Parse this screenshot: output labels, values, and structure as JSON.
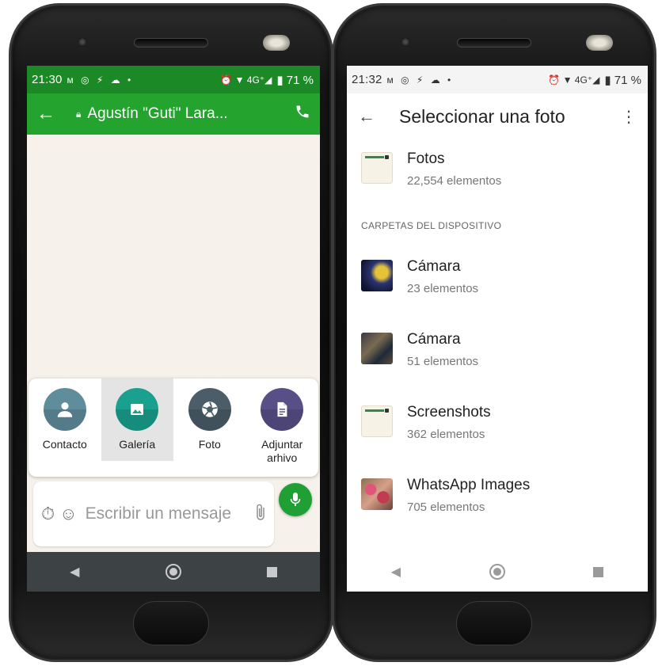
{
  "left": {
    "status": {
      "time": "21:30",
      "left_icons": "ᴍ ◎ ⚡ ☁ •",
      "right_icons": "⏰ ▼ 4G⁺◢",
      "battery": "▮ 71 %"
    },
    "toolbar": {
      "title": "Agustín \"Guti\" Lara..."
    },
    "attach": [
      {
        "label": "Contacto",
        "color": "#5f8d9c",
        "icon": "person-icon"
      },
      {
        "label": "Galería",
        "color": "#1aa08f",
        "icon": "image-icon"
      },
      {
        "label": "Foto",
        "color": "#4a5d68",
        "icon": "camera-shutter-icon"
      },
      {
        "label": "Adjuntar arhivo",
        "color": "#574f86",
        "icon": "document-icon"
      }
    ],
    "compose": {
      "placeholder": "Escribir un mensaje"
    }
  },
  "right": {
    "status": {
      "time": "21:32",
      "left_icons": "ᴍ ◎ ⚡ ☁ •",
      "right_icons": "⏰ ▼ 4G⁺◢",
      "battery": "▮ 71 %"
    },
    "toolbar": {
      "title": "Seleccionar una foto"
    },
    "top_item": {
      "name": "Fotos",
      "count": "22,554 elementos"
    },
    "section_title": "CARPETAS DEL DISPOSITIVO",
    "folders": [
      {
        "name": "Cámara",
        "count": "23 elementos"
      },
      {
        "name": "Cámara",
        "count": "51 elementos"
      },
      {
        "name": "Screenshots",
        "count": "362 elementos"
      },
      {
        "name": "WhatsApp Images",
        "count": "705 elementos"
      }
    ]
  },
  "colors": {
    "whatsapp_green": "#25a32f",
    "whatsapp_dark_green": "#1b8a26",
    "chat_bg": "#f6f1ea",
    "mic_green": "#1f9f34"
  }
}
